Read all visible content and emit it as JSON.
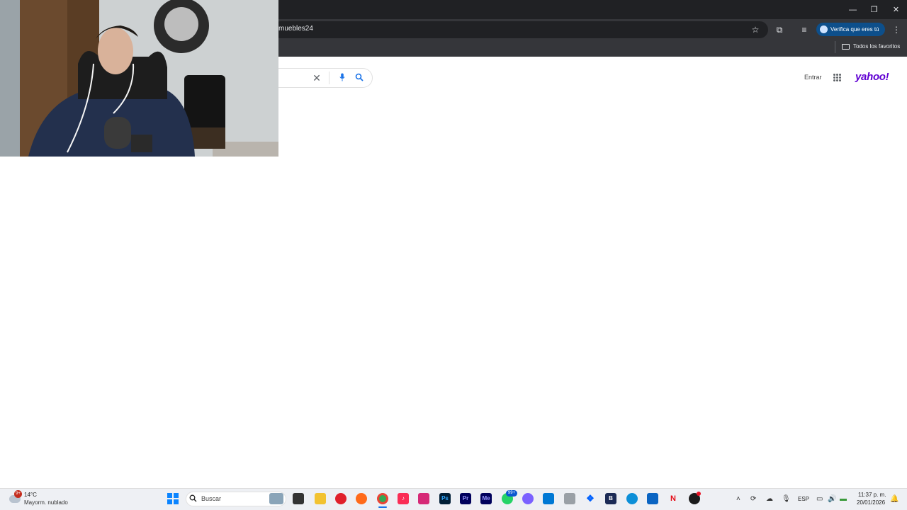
{
  "browser": {
    "url_visible": "muebles24",
    "verify_label": "Verifica que eres tú",
    "bookmarks_all": "Todos los favoritos",
    "window_controls": [
      "minimize-icon",
      "restore-icon",
      "close-icon"
    ]
  },
  "page": {
    "signin_label": "Entrar",
    "logo_text": "yahoo!",
    "brand_color": "#6001d2",
    "search_icons": [
      "clear-icon",
      "microphone-icon",
      "search-icon"
    ]
  },
  "taskbar": {
    "weather_badge": "9+",
    "weather_temp": "14°C",
    "weather_desc": "Mayorm. nublado",
    "search_placeholder": "Buscar",
    "whatsapp_badge": "99+",
    "language": "ESP",
    "time": "11:37 p. m.",
    "date": "20/01/2026",
    "apps": [
      "Opera",
      "Firefox",
      "Chrome",
      "Music",
      "Instagram",
      "Ps",
      "Pr",
      "Me",
      "WhatsApp",
      "Copilot",
      "Store",
      "Dropbox",
      "B",
      "Edge",
      "Outlook",
      "N",
      "Steam"
    ]
  }
}
